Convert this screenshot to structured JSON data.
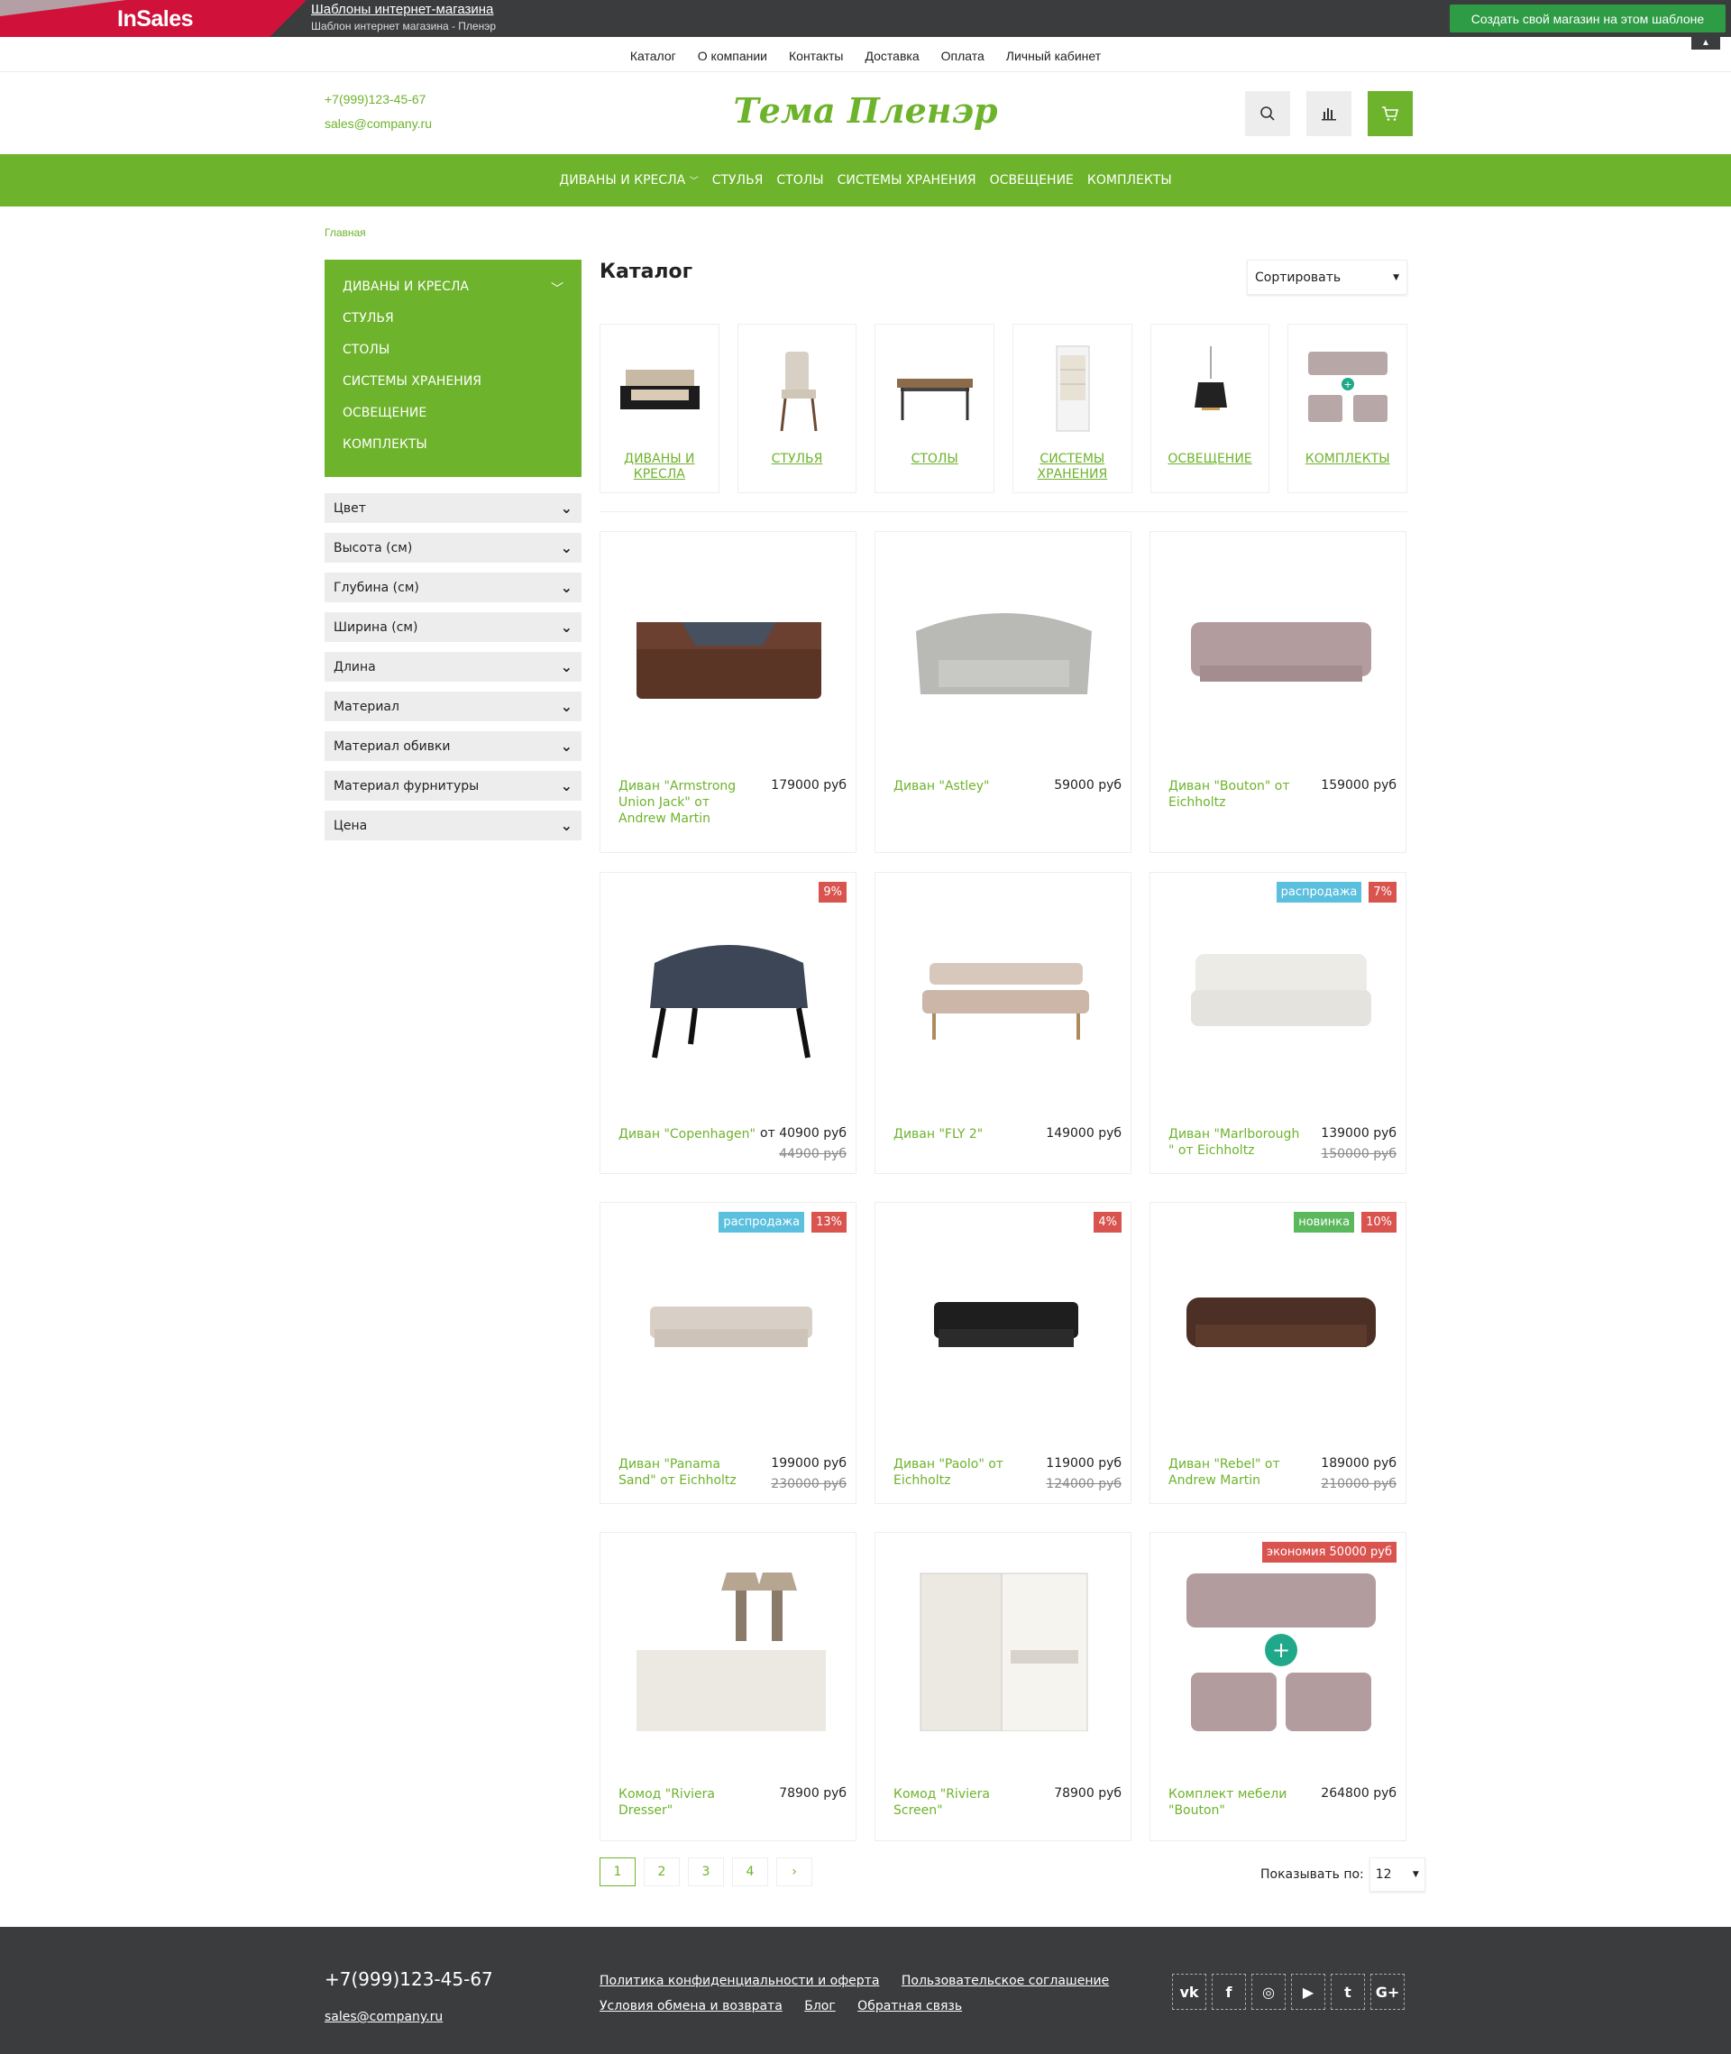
{
  "promo": {
    "logo": "InSales",
    "link": "Шаблоны интернет-магазина",
    "subtitle": "Шаблон интернет магазина - Пленэр",
    "cta": "Создать свой магазин на этом шаблоне"
  },
  "topnav": [
    "Каталог",
    "О компании",
    "Контакты",
    "Доставка",
    "Оплата",
    "Личный кабинет"
  ],
  "header": {
    "phone": "+7(999)123-45-67",
    "email": "sales@company.ru",
    "brand": "Тема Пленэр",
    "icons": [
      "search-icon",
      "compare-icon",
      "cart-icon"
    ]
  },
  "mainmenu": [
    "Диваны и кресла",
    "Стулья",
    "Столы",
    "Системы хранения",
    "Освещение",
    "Комплекты"
  ],
  "breadcrumb": "Главная",
  "sidebar": {
    "categories": [
      "Диваны и кресла",
      "Стулья",
      "Столы",
      "Системы хранения",
      "Освещение",
      "Комплекты"
    ],
    "filters": [
      "Цвет",
      "Высота (см)",
      "Глубина (см)",
      "Ширина (см)",
      "Длина",
      "Материал",
      "Материал обивки",
      "Материал фурнитуры",
      "Цена"
    ]
  },
  "catalog": {
    "title": "Каталог",
    "sort_label": "Сортировать",
    "categories": [
      {
        "label": "Диваны и кресла"
      },
      {
        "label": "Стулья"
      },
      {
        "label": "Столы"
      },
      {
        "label": "Системы хранения"
      },
      {
        "label": "Освещение"
      },
      {
        "label": "Комплекты"
      }
    ],
    "products": [
      {
        "name": "Диван \"Armstrong Union Jack\" от Andrew Martin",
        "price": "179000 руб",
        "old": "",
        "badges": []
      },
      {
        "name": "Диван \"Astley\"",
        "price": "59000 руб",
        "old": "",
        "badges": []
      },
      {
        "name": "Диван \"Bouton\" от Eichholtz",
        "price": "159000 руб",
        "old": "",
        "badges": []
      },
      {
        "name": "Диван \"Copenhagen\"",
        "price": "от 40900 руб",
        "old": "44900 руб",
        "badges": [
          {
            "t": "9%",
            "k": "disc"
          }
        ]
      },
      {
        "name": "Диван \"FLY 2\"",
        "price": "149000 руб",
        "old": "",
        "badges": []
      },
      {
        "name": "Диван \"Marlborough \" от Eichholtz",
        "price": "139000 руб",
        "old": "150000 руб",
        "badges": [
          {
            "t": "распродажа",
            "k": "sale"
          },
          {
            "t": "7%",
            "k": "disc"
          }
        ]
      },
      {
        "name": "Диван \"Panama Sand\" от Eichholtz",
        "price": "199000 руб",
        "old": "230000 руб",
        "badges": [
          {
            "t": "распродажа",
            "k": "sale"
          },
          {
            "t": "13%",
            "k": "disc"
          }
        ]
      },
      {
        "name": "Диван \"Paolo\" от Eichholtz",
        "price": "119000 руб",
        "old": "124000 руб",
        "badges": [
          {
            "t": "4%",
            "k": "disc"
          }
        ]
      },
      {
        "name": "Диван \"Rebel\" от Andrew Martin",
        "price": "189000 руб",
        "old": "210000 руб",
        "badges": [
          {
            "t": "новинка",
            "k": "new"
          },
          {
            "t": "10%",
            "k": "disc"
          }
        ]
      },
      {
        "name": "Комод \"Riviera Dresser\"",
        "price": "78900 руб",
        "old": "",
        "badges": []
      },
      {
        "name": "Комод \"Riviera Screen\"",
        "price": "78900 руб",
        "old": "",
        "badges": []
      },
      {
        "name": "Комплект мебели \"Bouton\"",
        "price": "264800 руб",
        "old": "",
        "badges": [
          {
            "t": "экономия 50000 руб",
            "k": "disc"
          }
        ]
      }
    ]
  },
  "pager": {
    "pages": [
      "1",
      "2",
      "3",
      "4",
      "›"
    ],
    "per_page_label": "Показывать по:",
    "per_page_value": "12"
  },
  "footer": {
    "phone": "+7(999)123-45-67",
    "email": "sales@company.ru",
    "links_row1": [
      "Политика конфиденциальности и оферта",
      "Пользовательское соглашение"
    ],
    "links_row2": [
      "Условия обмена и возврата",
      "Блог",
      "Обратная связь"
    ],
    "socials": [
      {
        "icon": "vk-icon",
        "glyph": "vk"
      },
      {
        "icon": "facebook-icon",
        "glyph": "f"
      },
      {
        "icon": "instagram-icon",
        "glyph": "◎"
      },
      {
        "icon": "youtube-icon",
        "glyph": "▶"
      },
      {
        "icon": "twitter-icon",
        "glyph": "t"
      },
      {
        "icon": "google-plus-icon",
        "glyph": "G+"
      }
    ]
  },
  "colors": {
    "accent": "#6db32b",
    "dark": "#3b3c3d",
    "promo_red": "#d0113a",
    "cta_green": "#2e9b45"
  }
}
